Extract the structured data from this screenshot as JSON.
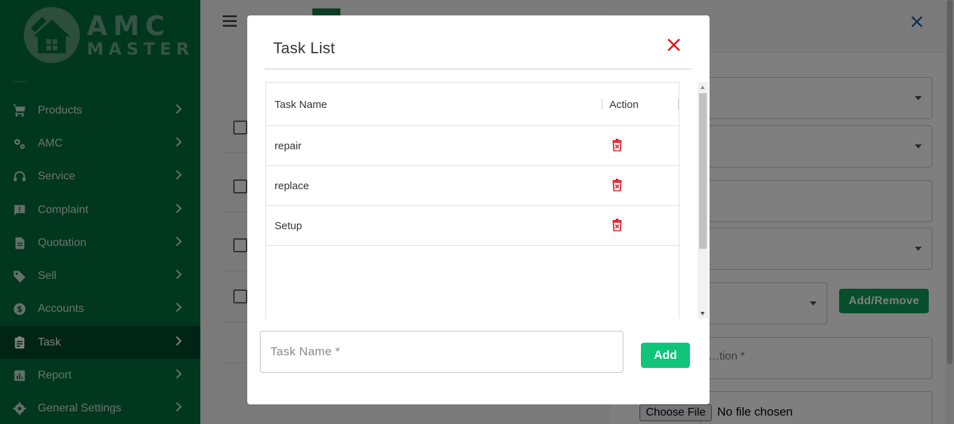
{
  "brand": {
    "line1": "AMC",
    "line2": "MASTER"
  },
  "sidebar": {
    "items": [
      {
        "label": "Products",
        "icon": "cart-icon"
      },
      {
        "label": "AMC",
        "icon": "gears-icon"
      },
      {
        "label": "Service",
        "icon": "headset-icon"
      },
      {
        "label": "Complaint",
        "icon": "chat-alert-icon"
      },
      {
        "label": "Quotation",
        "icon": "document-icon"
      },
      {
        "label": "Sell",
        "icon": "tag-icon"
      },
      {
        "label": "Accounts",
        "icon": "dollar-coin-icon"
      },
      {
        "label": "Task",
        "icon": "clipboard-icon",
        "active": true
      },
      {
        "label": "Report",
        "icon": "bar-report-icon"
      },
      {
        "label": "General Settings",
        "icon": "gear-icon"
      }
    ]
  },
  "drawer": {
    "add_remove_label": "Add/Remove",
    "description_placeholder": "…tion *",
    "choose_file_label": "Choose File",
    "no_file_text": "No file chosen"
  },
  "modal": {
    "title": "Task List",
    "columns": {
      "name": "Task Name",
      "action": "Action"
    },
    "rows": [
      {
        "name": "repair"
      },
      {
        "name": "replace"
      },
      {
        "name": "Setup"
      }
    ],
    "input_placeholder": "Task Name *",
    "add_label": "Add"
  },
  "colors": {
    "sidebar": "#006e3c",
    "sidebar_active": "#01492a",
    "delete_red": "#e0242b",
    "close_red": "#e8100f",
    "add_green": "#10c47a"
  }
}
